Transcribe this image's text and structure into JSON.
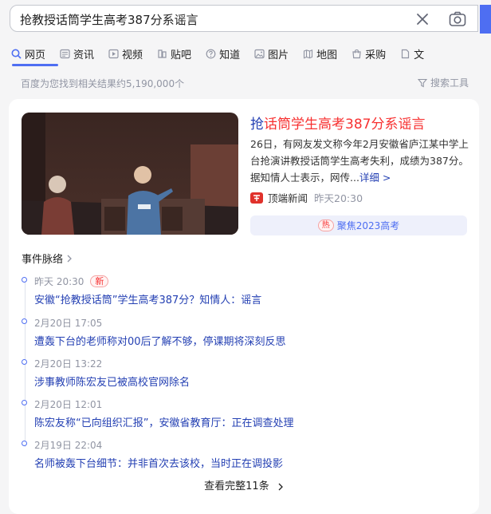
{
  "search": {
    "query": "抢教授话筒学生高考387分系谣言"
  },
  "tabs": [
    {
      "label": "网页",
      "icon": "search-icon"
    },
    {
      "label": "资讯",
      "icon": "news-icon"
    },
    {
      "label": "视频",
      "icon": "video-icon"
    },
    {
      "label": "贴吧",
      "icon": "tieba-icon"
    },
    {
      "label": "知道",
      "icon": "question-icon"
    },
    {
      "label": "图片",
      "icon": "image-icon"
    },
    {
      "label": "地图",
      "icon": "map-icon"
    },
    {
      "label": "采购",
      "icon": "purchase-icon"
    },
    {
      "label": "文",
      "icon": "doc-icon"
    }
  ],
  "results": {
    "count_text": "百度为您找到相关结果约5,190,000个",
    "tools_label": "搜索工具"
  },
  "news": {
    "title_prefix": "抢",
    "title_highlight": "话筒学生高考387分系谣言",
    "summary": "26日，有网友发文称今年2月安徽省庐江某中学上台抢演讲教授话筒学生高考失利，成绩为387分。据知情人士表示，网传...",
    "more_label": "详细 >",
    "source_name": "顶端新闻",
    "source_time": "昨天20:30",
    "topic_badge": "热",
    "topic_label": "聚焦2023高考"
  },
  "timeline": {
    "heading": "事件脉络",
    "items": [
      {
        "time": "昨天 20:30",
        "badge": "新",
        "text": "安徽“抢教授话筒”学生高考387分？知情人：谣言"
      },
      {
        "time": "2月20日 17:05",
        "text": "遭轰下台的老师称对00后了解不够，停课期将深刻反思"
      },
      {
        "time": "2月20日 13:22",
        "text": "涉事教师陈宏友已被高校官网除名"
      },
      {
        "time": "2月20日 12:01",
        "text": "陈宏友称“已向组织汇报”，安徽省教育厅：正在调查处理"
      },
      {
        "time": "2月19日 22:04",
        "text": "名师被轰下台细节：并非首次去该校，当时正在调投影"
      }
    ],
    "view_all_label": "查看完整11条"
  },
  "colors": {
    "accent": "#4e6ef2",
    "link": "#2440b3",
    "highlight": "#f73131"
  }
}
